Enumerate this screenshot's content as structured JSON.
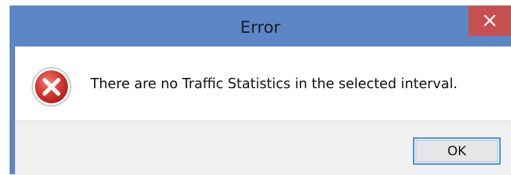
{
  "dialog": {
    "title": "Error",
    "close_icon": "close-icon",
    "message_icon": "error-icon",
    "message": "There are no Traffic Statistics in the selected interval.",
    "ok_label": "OK"
  },
  "colors": {
    "titlebar": "#5d86c7",
    "close_button": "#c75050",
    "ok_focus_border": "#3c8ce0",
    "error_red": "#d13a34"
  }
}
